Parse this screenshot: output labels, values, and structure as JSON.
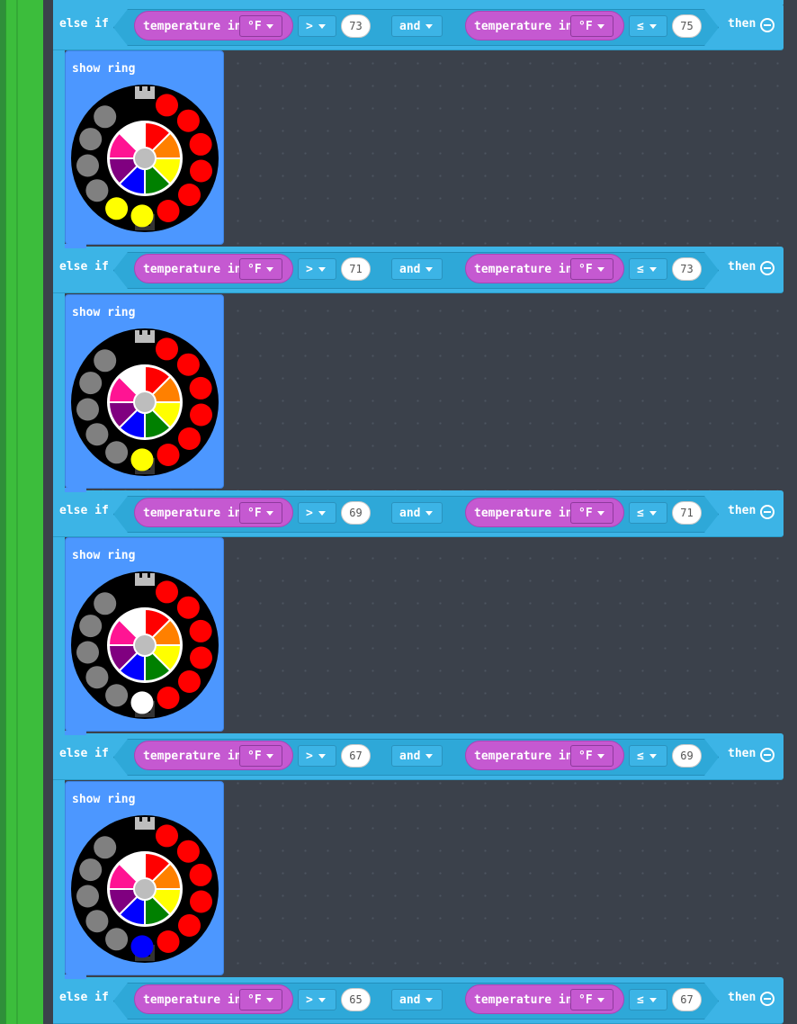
{
  "blocks": [
    {
      "else_label": "else if",
      "var_label": "temperature in",
      "unit": "°F",
      "op1": ">",
      "val1": "73",
      "conj": "and",
      "var2_label": "temperature in",
      "unit2": "°F",
      "op2": "≤",
      "val2": "75",
      "then_label": "then",
      "show_label": "show ring",
      "ring": [
        "#ff0000",
        "#ff0000",
        "#ff0000",
        "#ff0000",
        "#ff0000",
        "#ff0000",
        "#ffff00",
        "#ffff00",
        "#808080",
        "#808080",
        "#808080",
        "#808080"
      ]
    },
    {
      "else_label": "else if",
      "var_label": "temperature in",
      "unit": "°F",
      "op1": ">",
      "val1": "71",
      "conj": "and",
      "var2_label": "temperature in",
      "unit2": "°F",
      "op2": "≤",
      "val2": "73",
      "then_label": "then",
      "show_label": "show ring",
      "ring": [
        "#ff0000",
        "#ff0000",
        "#ff0000",
        "#ff0000",
        "#ff0000",
        "#ff0000",
        "#ffff00",
        "#808080",
        "#808080",
        "#808080",
        "#808080",
        "#808080"
      ]
    },
    {
      "else_label": "else if",
      "var_label": "temperature in",
      "unit": "°F",
      "op1": ">",
      "val1": "69",
      "conj": "and",
      "var2_label": "temperature in",
      "unit2": "°F",
      "op2": "≤",
      "val2": "71",
      "then_label": "then",
      "show_label": "show ring",
      "ring": [
        "#ff0000",
        "#ff0000",
        "#ff0000",
        "#ff0000",
        "#ff0000",
        "#ff0000",
        "#ffffff",
        "#808080",
        "#808080",
        "#808080",
        "#808080",
        "#808080"
      ]
    },
    {
      "else_label": "else if",
      "var_label": "temperature in",
      "unit": "°F",
      "op1": ">",
      "val1": "67",
      "conj": "and",
      "var2_label": "temperature in",
      "unit2": "°F",
      "op2": "≤",
      "val2": "69",
      "then_label": "then",
      "show_label": "show ring",
      "ring": [
        "#ff0000",
        "#ff0000",
        "#ff0000",
        "#ff0000",
        "#ff0000",
        "#ff0000",
        "#0000ff",
        "#808080",
        "#808080",
        "#808080",
        "#808080",
        "#808080"
      ]
    },
    {
      "else_label": "else if",
      "var_label": "temperature in",
      "unit": "°F",
      "op1": ">",
      "val1": "65",
      "conj": "and",
      "var2_label": "temperature in",
      "unit2": "°F",
      "op2": "≤",
      "val2": "67",
      "then_label": "then"
    }
  ],
  "palette_colors": [
    "#ff0000",
    "#ff8000",
    "#ffff00",
    "#008000",
    "#0000ff",
    "#800080",
    "#ff1493",
    "#ffffff"
  ]
}
